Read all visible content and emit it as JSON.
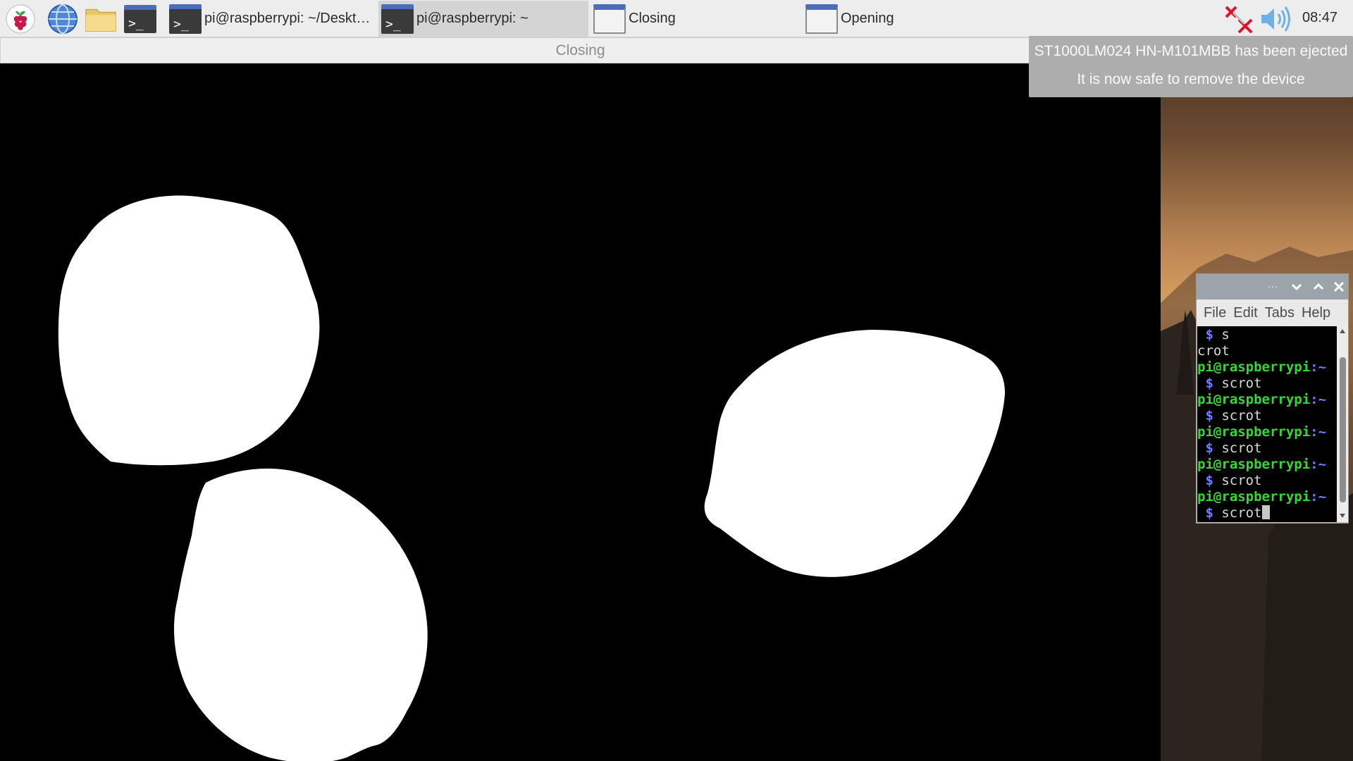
{
  "taskbar": {
    "launchers": [
      {
        "name": "raspberry-menu-icon"
      },
      {
        "name": "web-browser-icon"
      },
      {
        "name": "file-manager-icon"
      },
      {
        "name": "terminal-launcher-icon"
      }
    ],
    "tasks": [
      {
        "label": "pi@raspberrypi: ~/Deskt…",
        "icon": "terminal-icon",
        "active": false
      },
      {
        "label": "pi@raspberrypi: ~",
        "icon": "terminal-icon",
        "active": true
      },
      {
        "label": "Closing",
        "icon": "window-icon",
        "active": false
      },
      {
        "label": "Opening",
        "icon": "window-icon",
        "active": false
      }
    ],
    "tray": {
      "network_icon": "network-disconnected-icon",
      "volume_icon": "volume-icon",
      "clock": "08:47"
    }
  },
  "notification": {
    "line1": "ST1000LM024 HN-M101MBB has been ejected",
    "line2": "It is now safe to remove the device"
  },
  "closing_window": {
    "title": "Closing"
  },
  "terminal": {
    "ellipsis": "…",
    "menu": [
      "File",
      "Edit",
      "Tabs",
      "Help"
    ],
    "prompt_user": "pi@raspberrypi",
    "prompt_path": ":~",
    "lines": [
      {
        "kind": "cmd-cont",
        "text": "s"
      },
      {
        "kind": "out",
        "text": "crot"
      },
      {
        "kind": "prompt"
      },
      {
        "kind": "cmd",
        "text": "scrot"
      },
      {
        "kind": "prompt"
      },
      {
        "kind": "cmd",
        "text": "scrot"
      },
      {
        "kind": "prompt"
      },
      {
        "kind": "cmd",
        "text": "scrot"
      },
      {
        "kind": "prompt"
      },
      {
        "kind": "cmd",
        "text": "scrot"
      },
      {
        "kind": "prompt"
      },
      {
        "kind": "cmd-cursor",
        "text": "scrot"
      }
    ]
  },
  "colors": {
    "taskbar_bg": "#ededed",
    "notification_bg": "#adadad",
    "terminal_prompt_user": "#35d735",
    "terminal_prompt_path": "#6f7dff"
  }
}
